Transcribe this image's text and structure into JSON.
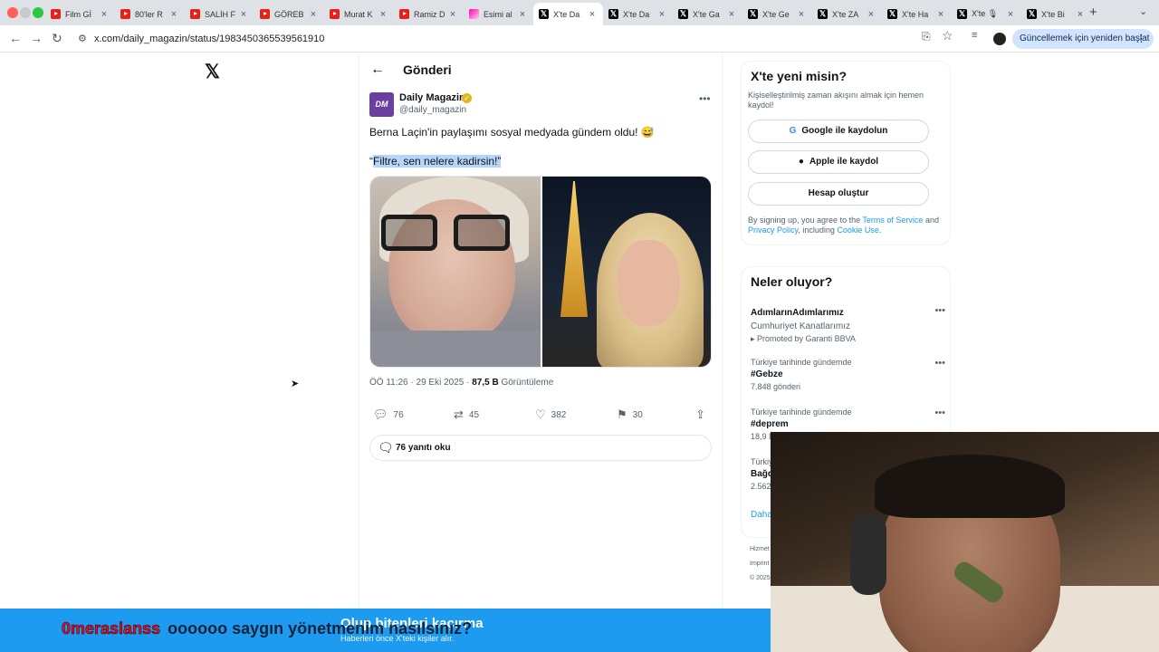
{
  "browser": {
    "tabs": [
      {
        "label": "Film Gİ",
        "favicon": "youtube-icon",
        "active": false
      },
      {
        "label": "80'ler R",
        "favicon": "youtube-icon",
        "active": false
      },
      {
        "label": "SALİH F",
        "favicon": "youtube-icon",
        "active": false
      },
      {
        "label": "GÖREB",
        "favicon": "youtube-icon",
        "active": false
      },
      {
        "label": "Murat K",
        "favicon": "youtube-icon",
        "active": false
      },
      {
        "label": "Ramiz D",
        "favicon": "youtube-icon",
        "active": false
      },
      {
        "label": "Esimi al",
        "favicon": "image-icon",
        "active": false
      },
      {
        "label": "X'te Da",
        "favicon": "x-icon",
        "active": true
      },
      {
        "label": "X'te Da",
        "favicon": "x-icon",
        "active": false
      },
      {
        "label": "X'te Ga",
        "favicon": "x-icon",
        "active": false
      },
      {
        "label": "X'te Ge",
        "favicon": "x-icon",
        "active": false
      },
      {
        "label": "X'te ZA",
        "favicon": "x-icon",
        "active": false
      },
      {
        "label": "X'te Ha",
        "favicon": "x-icon",
        "active": false
      },
      {
        "label": "X'te 🎙",
        "favicon": "x-icon",
        "active": false
      },
      {
        "label": "X'te Bi",
        "favicon": "x-icon",
        "active": false
      }
    ],
    "url": "x.com/daily_magazin/status/1983450365539561910",
    "relaunch_label": "Güncellemek için yeniden başlat"
  },
  "post": {
    "header_title": "Gönderi",
    "author_name": "Daily Magazin",
    "author_handle": "@daily_magazin",
    "avatar_text": "DM",
    "text": "Berna Laçin'in paylaşımı sosyal medyada gündem oldu! 😅",
    "quote_open": "“",
    "quote_highlight": "Filtre, sen nelere kadirsin!”",
    "time_date": "ÖÖ 11:26 · 29 Eki 2025 · ",
    "views_count": "87,5 B",
    "views_label": " Görüntüleme",
    "actions": {
      "replies": "76",
      "reposts": "45",
      "likes": "382",
      "bookmarks": "30"
    },
    "read_replies_label": "76 yanıtı oku"
  },
  "signup": {
    "title": "X'te yeni misin?",
    "subtitle": "Kişiselleştirilmiş zaman akışını almak için hemen kaydol!",
    "google_label": "Google ile kaydolun",
    "apple_label": "Apple ile kaydol",
    "create_label": "Hesap oluştur",
    "terms_prefix": "By signing up, you agree to the ",
    "terms_link": "Terms of Service",
    "terms_and": " and ",
    "privacy_link": "Privacy Policy",
    "terms_including": ", including ",
    "cookie_link": "Cookie Use",
    "terms_end": "."
  },
  "trends": {
    "title": "Neler oluyor?",
    "items": [
      {
        "name": "AdımlarınAdımlarımız",
        "sub": "Cumhuriyet Kanatlarımız",
        "count": "Promoted by Garanti BBVA"
      },
      {
        "context": "Türkiye tarihinde gündemde",
        "name": "#Gebze",
        "count": "7.848 gönderi"
      },
      {
        "context": "Türkiye tarihinde gündemde",
        "name": "#deprem",
        "count": "18,9 B"
      },
      {
        "context": "Türkiye",
        "name": "Bağd",
        "count": "2.562"
      }
    ],
    "show_more": "Daha"
  },
  "footer": {
    "line1": "Hizmet",
    "line2": "Imprint",
    "line3": "© 2025"
  },
  "banner": {
    "title": "Olup bitenleri kaçırma",
    "subtitle": "Haberleri önce X'teki kişiler alır."
  },
  "stream": {
    "username": "0meraslanss",
    "message": "oooooo saygın yönetmenim nasılsınız?"
  },
  "colors": {
    "accent": "#1d9bf0",
    "verified": "#e3b51b",
    "relaunch_bg": "#d3e3fd"
  }
}
